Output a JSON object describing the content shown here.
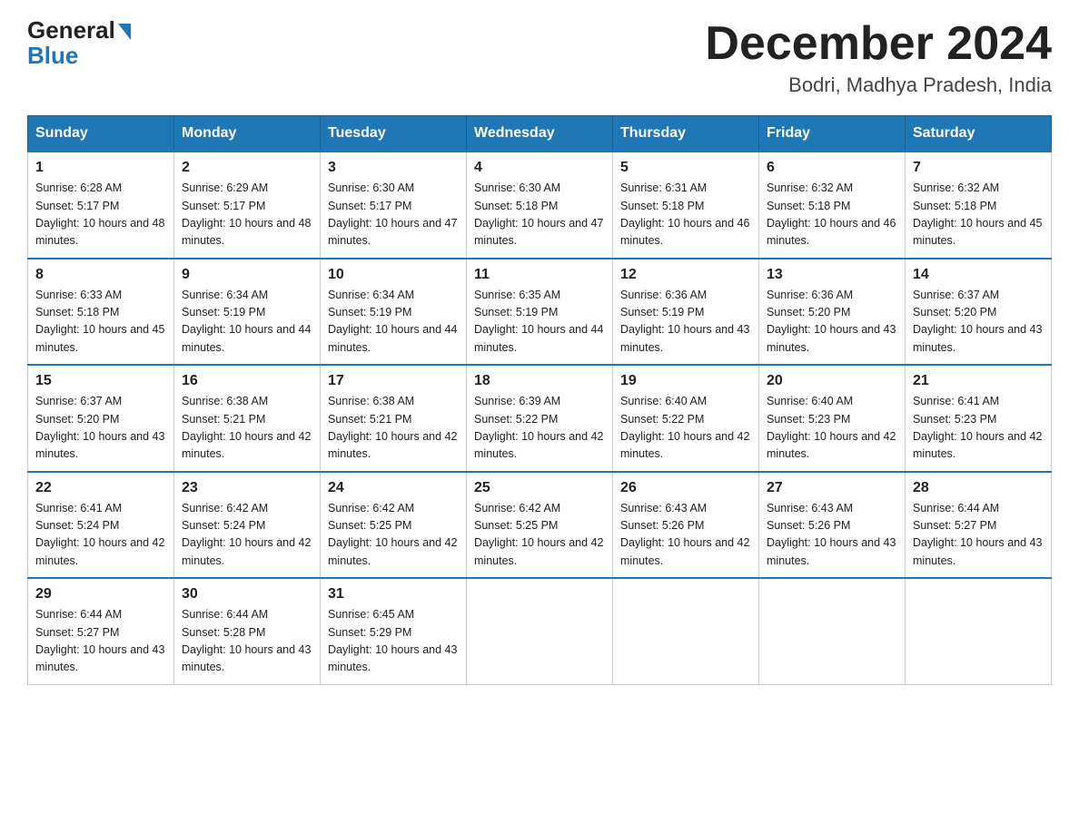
{
  "header": {
    "logo_general": "General",
    "logo_blue": "Blue",
    "title": "December 2024",
    "subtitle": "Bodri, Madhya Pradesh, India"
  },
  "days_of_week": [
    "Sunday",
    "Monday",
    "Tuesday",
    "Wednesday",
    "Thursday",
    "Friday",
    "Saturday"
  ],
  "weeks": [
    [
      {
        "day": "1",
        "sunrise": "6:28 AM",
        "sunset": "5:17 PM",
        "daylight": "10 hours and 48 minutes."
      },
      {
        "day": "2",
        "sunrise": "6:29 AM",
        "sunset": "5:17 PM",
        "daylight": "10 hours and 48 minutes."
      },
      {
        "day": "3",
        "sunrise": "6:30 AM",
        "sunset": "5:17 PM",
        "daylight": "10 hours and 47 minutes."
      },
      {
        "day": "4",
        "sunrise": "6:30 AM",
        "sunset": "5:18 PM",
        "daylight": "10 hours and 47 minutes."
      },
      {
        "day": "5",
        "sunrise": "6:31 AM",
        "sunset": "5:18 PM",
        "daylight": "10 hours and 46 minutes."
      },
      {
        "day": "6",
        "sunrise": "6:32 AM",
        "sunset": "5:18 PM",
        "daylight": "10 hours and 46 minutes."
      },
      {
        "day": "7",
        "sunrise": "6:32 AM",
        "sunset": "5:18 PM",
        "daylight": "10 hours and 45 minutes."
      }
    ],
    [
      {
        "day": "8",
        "sunrise": "6:33 AM",
        "sunset": "5:18 PM",
        "daylight": "10 hours and 45 minutes."
      },
      {
        "day": "9",
        "sunrise": "6:34 AM",
        "sunset": "5:19 PM",
        "daylight": "10 hours and 44 minutes."
      },
      {
        "day": "10",
        "sunrise": "6:34 AM",
        "sunset": "5:19 PM",
        "daylight": "10 hours and 44 minutes."
      },
      {
        "day": "11",
        "sunrise": "6:35 AM",
        "sunset": "5:19 PM",
        "daylight": "10 hours and 44 minutes."
      },
      {
        "day": "12",
        "sunrise": "6:36 AM",
        "sunset": "5:19 PM",
        "daylight": "10 hours and 43 minutes."
      },
      {
        "day": "13",
        "sunrise": "6:36 AM",
        "sunset": "5:20 PM",
        "daylight": "10 hours and 43 minutes."
      },
      {
        "day": "14",
        "sunrise": "6:37 AM",
        "sunset": "5:20 PM",
        "daylight": "10 hours and 43 minutes."
      }
    ],
    [
      {
        "day": "15",
        "sunrise": "6:37 AM",
        "sunset": "5:20 PM",
        "daylight": "10 hours and 43 minutes."
      },
      {
        "day": "16",
        "sunrise": "6:38 AM",
        "sunset": "5:21 PM",
        "daylight": "10 hours and 42 minutes."
      },
      {
        "day": "17",
        "sunrise": "6:38 AM",
        "sunset": "5:21 PM",
        "daylight": "10 hours and 42 minutes."
      },
      {
        "day": "18",
        "sunrise": "6:39 AM",
        "sunset": "5:22 PM",
        "daylight": "10 hours and 42 minutes."
      },
      {
        "day": "19",
        "sunrise": "6:40 AM",
        "sunset": "5:22 PM",
        "daylight": "10 hours and 42 minutes."
      },
      {
        "day": "20",
        "sunrise": "6:40 AM",
        "sunset": "5:23 PM",
        "daylight": "10 hours and 42 minutes."
      },
      {
        "day": "21",
        "sunrise": "6:41 AM",
        "sunset": "5:23 PM",
        "daylight": "10 hours and 42 minutes."
      }
    ],
    [
      {
        "day": "22",
        "sunrise": "6:41 AM",
        "sunset": "5:24 PM",
        "daylight": "10 hours and 42 minutes."
      },
      {
        "day": "23",
        "sunrise": "6:42 AM",
        "sunset": "5:24 PM",
        "daylight": "10 hours and 42 minutes."
      },
      {
        "day": "24",
        "sunrise": "6:42 AM",
        "sunset": "5:25 PM",
        "daylight": "10 hours and 42 minutes."
      },
      {
        "day": "25",
        "sunrise": "6:42 AM",
        "sunset": "5:25 PM",
        "daylight": "10 hours and 42 minutes."
      },
      {
        "day": "26",
        "sunrise": "6:43 AM",
        "sunset": "5:26 PM",
        "daylight": "10 hours and 42 minutes."
      },
      {
        "day": "27",
        "sunrise": "6:43 AM",
        "sunset": "5:26 PM",
        "daylight": "10 hours and 43 minutes."
      },
      {
        "day": "28",
        "sunrise": "6:44 AM",
        "sunset": "5:27 PM",
        "daylight": "10 hours and 43 minutes."
      }
    ],
    [
      {
        "day": "29",
        "sunrise": "6:44 AM",
        "sunset": "5:27 PM",
        "daylight": "10 hours and 43 minutes."
      },
      {
        "day": "30",
        "sunrise": "6:44 AM",
        "sunset": "5:28 PM",
        "daylight": "10 hours and 43 minutes."
      },
      {
        "day": "31",
        "sunrise": "6:45 AM",
        "sunset": "5:29 PM",
        "daylight": "10 hours and 43 minutes."
      },
      null,
      null,
      null,
      null
    ]
  ]
}
